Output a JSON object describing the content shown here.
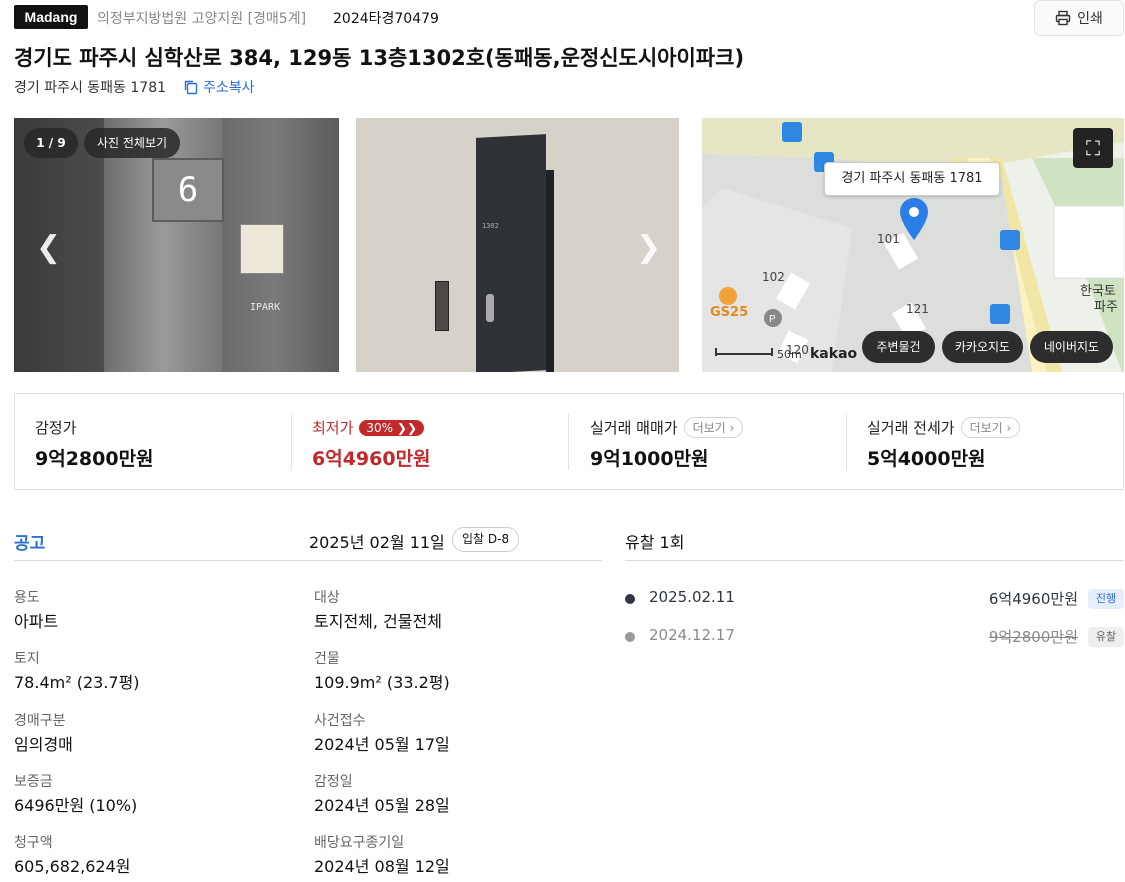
{
  "header": {
    "brand": "Madang",
    "court": "의정부지방법원 고양지원 [경매5계]",
    "case_no": "2024타경70479",
    "print_label": "인쇄"
  },
  "property": {
    "title": "경기도 파주시 심학산로 384, 129동 13층1302호(동패동,운정신도시아이파크)",
    "jibun": "경기 파주시 동패동 1781",
    "copy_label": "주소복사"
  },
  "gallery": {
    "counter": "1 / 9",
    "view_all": "사진 전체보기",
    "elevator_floor": "6",
    "elevator_brand": "IPARK",
    "door_number": "1302"
  },
  "map": {
    "address_label": "경기 파주시 동패동 1781",
    "buttons": [
      "주변물건",
      "카카오지도",
      "네이버지도"
    ],
    "scale": "50m",
    "provider": "kakao",
    "labels": {
      "b101": "101",
      "b102": "102",
      "b120": "120",
      "b121": "121",
      "gs": "GS25",
      "poi1": "한국토",
      "poi2": "파주"
    }
  },
  "prices": {
    "appraisal_label": "감정가",
    "appraisal_value": "9억2800만원",
    "min_label": "최저가",
    "min_pct": "30%",
    "min_value": "6억4960만원",
    "trade_label": "실거래 매매가",
    "trade_value": "9억1000만원",
    "jeonse_label": "실거래 전세가",
    "jeonse_value": "5억4000만원",
    "more_label": "더보기"
  },
  "notice": {
    "tag": "공고",
    "date": "2025년 02월 11일",
    "dday": "입찰 D-8"
  },
  "fields": {
    "usage_label": "용도",
    "usage": "아파트",
    "target_label": "대상",
    "target": "토지전체, 건물전체",
    "land_label": "토지",
    "land": "78.4m² (23.7평)",
    "building_label": "건물",
    "building": "109.9m² (33.2평)",
    "auction_type_label": "경매구분",
    "auction_type": "임의경매",
    "received_label": "사건접수",
    "received": "2024년 05월 17일",
    "deposit_label": "보증금",
    "deposit": "6496만원 (10%)",
    "appraisal_date_label": "감정일",
    "appraisal_date": "2024년 05월 28일",
    "claim_label": "청구액",
    "claim": "605,682,624원",
    "deadline_label": "배당요구종기일",
    "deadline": "2024년 08월 12일"
  },
  "history": {
    "title": "유찰 1회",
    "rows": [
      {
        "date": "2025.02.11",
        "price": "6억4960만원",
        "status": "진행"
      },
      {
        "date": "2024.12.17",
        "price": "9억2800만원",
        "status": "유찰"
      }
    ]
  },
  "colors": {
    "accent": "#2b6fd6",
    "danger": "#c02a2a"
  }
}
